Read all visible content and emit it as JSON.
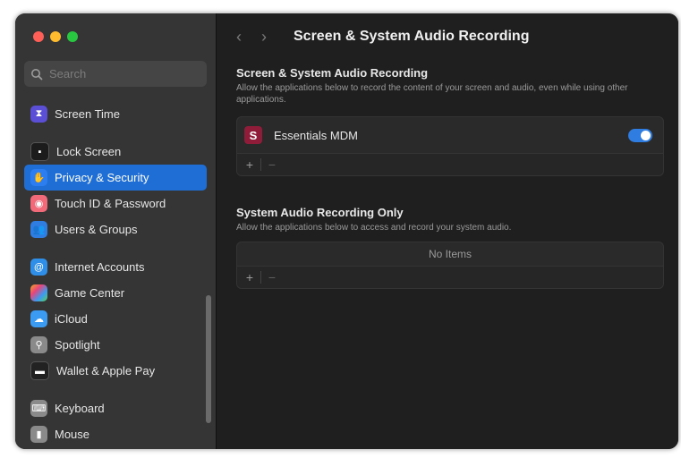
{
  "window": {
    "traffic_lights": [
      "close",
      "minimize",
      "zoom"
    ]
  },
  "sidebar": {
    "search": {
      "placeholder": "Search",
      "value": ""
    },
    "items": [
      {
        "label": "Screen Time",
        "icon": "hourglass-icon",
        "color": "#5b4fd6"
      },
      {
        "label": "Lock Screen",
        "icon": "lock-screen-icon",
        "color": "#1c1c1c"
      },
      {
        "label": "Privacy & Security",
        "icon": "hand-icon",
        "color": "#2c7df0",
        "selected": true
      },
      {
        "label": "Touch ID & Password",
        "icon": "fingerprint-icon",
        "color": "#f06a7a"
      },
      {
        "label": "Users & Groups",
        "icon": "users-icon",
        "color": "#2f7de1"
      },
      {
        "label": "Internet Accounts",
        "icon": "at-icon",
        "color": "#2f8fe8"
      },
      {
        "label": "Game Center",
        "icon": "game-center-icon",
        "color": "#e7e7e7"
      },
      {
        "label": "iCloud",
        "icon": "cloud-icon",
        "color": "#3b9af2"
      },
      {
        "label": "Spotlight",
        "icon": "magnifier-icon",
        "color": "#8a8a8a"
      },
      {
        "label": "Wallet & Apple Pay",
        "icon": "wallet-icon",
        "color": "#222222"
      },
      {
        "label": "Keyboard",
        "icon": "keyboard-icon",
        "color": "#8a8a8a"
      },
      {
        "label": "Mouse",
        "icon": "mouse-icon",
        "color": "#8a8a8a"
      }
    ]
  },
  "main": {
    "title": "Screen & System Audio Recording",
    "back_glyph": "‹",
    "forward_glyph": "›",
    "section1": {
      "title": "Screen & System Audio Recording",
      "description": "Allow the applications below to record the content of your screen and audio, even while using other applications.",
      "apps": [
        {
          "name": "Essentials MDM",
          "icon_glyph": "S",
          "enabled": true
        }
      ]
    },
    "section2": {
      "title": "System Audio Recording Only",
      "description": "Allow the applications below to access and record your system audio.",
      "empty_text": "No Items"
    },
    "plus_label": "+",
    "minus_label": "−"
  },
  "colors": {
    "accent": "#1f6ed6",
    "toggle_on": "#2f7de1"
  }
}
